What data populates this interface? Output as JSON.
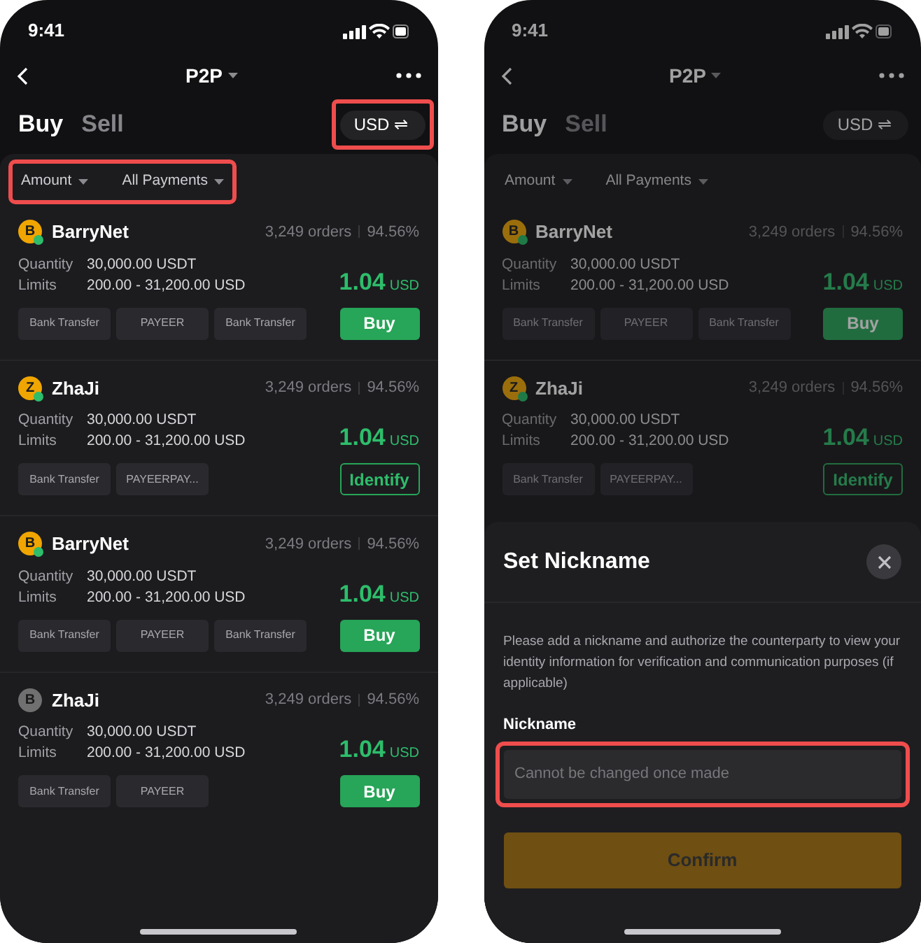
{
  "screens": [
    {
      "dimmed": false,
      "status_time": "9:41",
      "title": "P2P",
      "tabs": [
        {
          "label": "Buy",
          "selected": true
        },
        {
          "label": "Sell",
          "selected": false
        }
      ],
      "currency": {
        "label": "USD ⇌",
        "highlighted": true
      },
      "filters": {
        "highlighted": true,
        "items": [
          "Amount",
          "All Payments"
        ]
      },
      "listings": [
        {
          "name": "BarryNet",
          "avatar": "B",
          "color": "#f0a500",
          "online": true,
          "orders": "3,249 orders",
          "rate": "94.56%",
          "quantity_label": "Quantity",
          "quantity": "30,000.00 USDT",
          "limits_label": "Limits",
          "limits": "200.00 - 31,200.00 USD",
          "price": "1.04",
          "price_unit": "USD",
          "payments": [
            "Bank Transfer",
            "PAYEER",
            "Bank Transfer"
          ],
          "action": {
            "kind": "buy",
            "label": "Buy"
          }
        },
        {
          "name": "ZhaJi",
          "avatar": "Z",
          "color": "#f0a500",
          "online": true,
          "orders": "3,249 orders",
          "rate": "94.56%",
          "quantity_label": "Quantity",
          "quantity": "30,000.00 USDT",
          "limits_label": "Limits",
          "limits": "200.00 - 31,200.00 USD",
          "price": "1.04",
          "price_unit": "USD",
          "payments": [
            "Bank Transfer",
            "PAYEERPAY..."
          ],
          "action": {
            "kind": "identify",
            "label": "Identify"
          }
        },
        {
          "name": "BarryNet",
          "avatar": "B",
          "color": "#f0a500",
          "online": true,
          "orders": "3,249 orders",
          "rate": "94.56%",
          "quantity_label": "Quantity",
          "quantity": "30,000.00 USDT",
          "limits_label": "Limits",
          "limits": "200.00 - 31,200.00 USD",
          "price": "1.04",
          "price_unit": "USD",
          "payments": [
            "Bank Transfer",
            "PAYEER",
            "Bank Transfer"
          ],
          "action": {
            "kind": "buy",
            "label": "Buy"
          }
        },
        {
          "name": "ZhaJi",
          "avatar": "B",
          "color": "#707070",
          "online": false,
          "orders": "3,249 orders",
          "rate": "94.56%",
          "quantity_label": "Quantity",
          "quantity": "30,000.00 USDT",
          "limits_label": "Limits",
          "limits": "200.00 - 31,200.00 USD",
          "price": "1.04",
          "price_unit": "USD",
          "payments": [
            "Bank Transfer",
            "PAYEER"
          ],
          "action": {
            "kind": "buy",
            "label": "Buy"
          }
        }
      ]
    },
    {
      "dimmed": true,
      "status_time": "9:41",
      "title": "P2P",
      "tabs": [
        {
          "label": "Buy",
          "selected": true
        },
        {
          "label": "Sell",
          "selected": false
        }
      ],
      "currency": {
        "label": "USD ⇌",
        "highlighted": false
      },
      "filters": {
        "highlighted": false,
        "items": [
          "Amount",
          "All Payments"
        ]
      },
      "listings": [
        {
          "name": "BarryNet",
          "avatar": "B",
          "color": "#9b6e0c",
          "online": true,
          "orders": "3,249 orders",
          "rate": "94.56%",
          "quantity_label": "Quantity",
          "quantity": "30,000.00 USDT",
          "limits_label": "Limits",
          "limits": "200.00 - 31,200.00 USD",
          "price": "1.04",
          "price_unit": "USD",
          "payments": [
            "Bank Transfer",
            "PAYEER",
            "Bank Transfer"
          ],
          "action": {
            "kind": "buy",
            "label": "Buy"
          }
        },
        {
          "name": "ZhaJi",
          "avatar": "Z",
          "color": "#9b6e0c",
          "online": true,
          "orders": "3,249 orders",
          "rate": "94.56%",
          "quantity_label": "Quantity",
          "quantity": "30,000.00 USDT",
          "limits_label": "Limits",
          "limits": "200.00 - 31,200.00 USD",
          "price": "1.04",
          "price_unit": "USD",
          "payments": [
            "Bank Transfer",
            "PAYEERPAY..."
          ],
          "action": {
            "kind": "identify",
            "label": "Identify"
          }
        }
      ],
      "sheet": {
        "title": "Set Nickname",
        "description": "Please add a nickname and authorize the counterparty to view your identity information for verification and communication purposes (if applicable)",
        "field_label": "Nickname",
        "placeholder": "Cannot be changed once made",
        "field_highlighted": true,
        "confirm": "Confirm"
      }
    }
  ]
}
